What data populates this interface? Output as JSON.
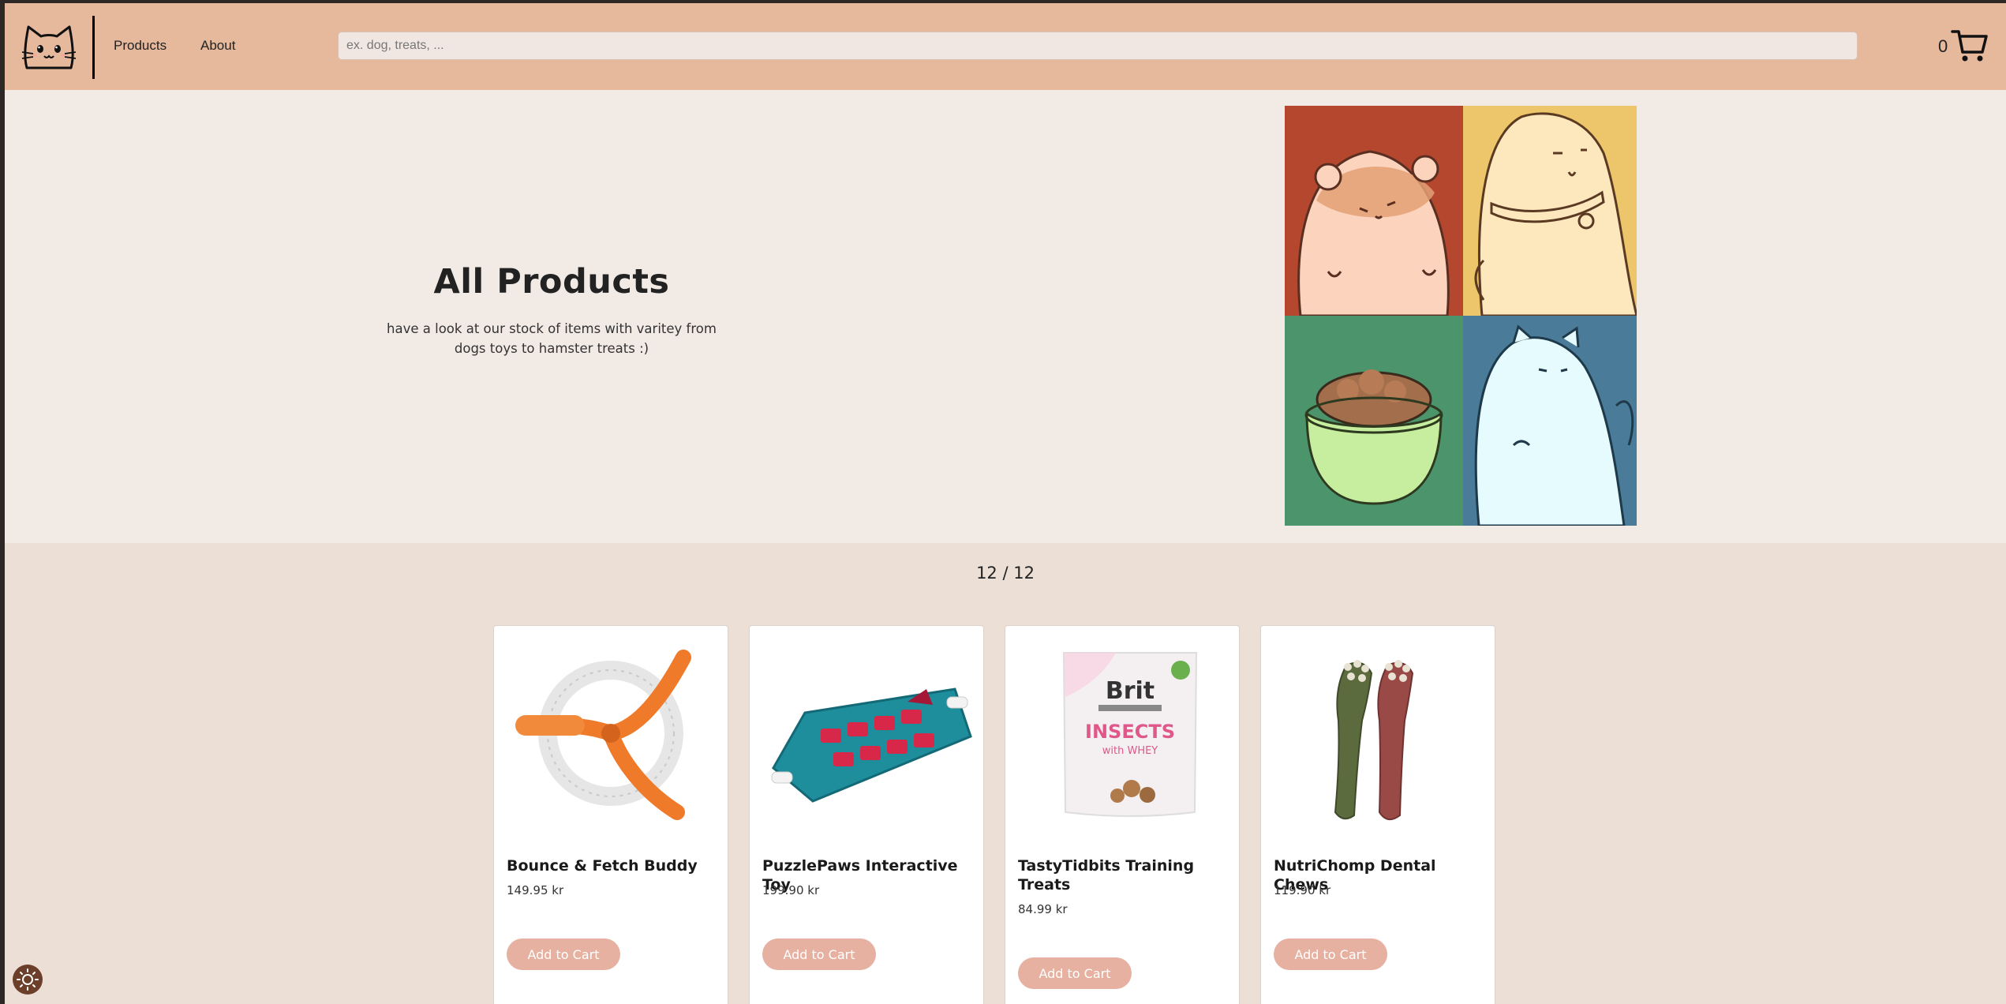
{
  "header": {
    "nav": [
      {
        "label": "Products"
      },
      {
        "label": "About"
      }
    ],
    "search_placeholder": "ex. dog, treats, ...",
    "cart_count": "0"
  },
  "hero": {
    "title": "All Products",
    "subtitle": "have a look at our stock of items with varitey from dogs toys to hamster treats :)"
  },
  "products_count": "12 / 12",
  "products": [
    {
      "name": "Bounce & Fetch Buddy",
      "price": "149.95 kr",
      "button": "Add to Cart"
    },
    {
      "name": "PuzzlePaws Interactive Toy",
      "price": "199.90 kr",
      "button": "Add to Cart"
    },
    {
      "name": "TastyTidbits Training Treats",
      "price": "84.99 kr",
      "button": "Add to Cart"
    },
    {
      "name": "NutriChomp Dental Chews",
      "price": "119.90 kr",
      "button": "Add to Cart"
    }
  ],
  "treat_package_text": {
    "brand": "Brit",
    "line1": "INSECTS",
    "line2": "with WHEY"
  },
  "colors": {
    "header_bg": "#e6b89c",
    "hero_bg": "#f2eae5",
    "page_bg": "#ebdfd6",
    "button_bg": "#e6b1a0",
    "tile_hamster": "#b5472e",
    "tile_dog": "#edc56a",
    "tile_food": "#4b946c",
    "tile_cat": "#4a7c9a"
  },
  "icons": [
    "cat-logo-icon",
    "cart-icon",
    "theme-toggle-icon"
  ]
}
